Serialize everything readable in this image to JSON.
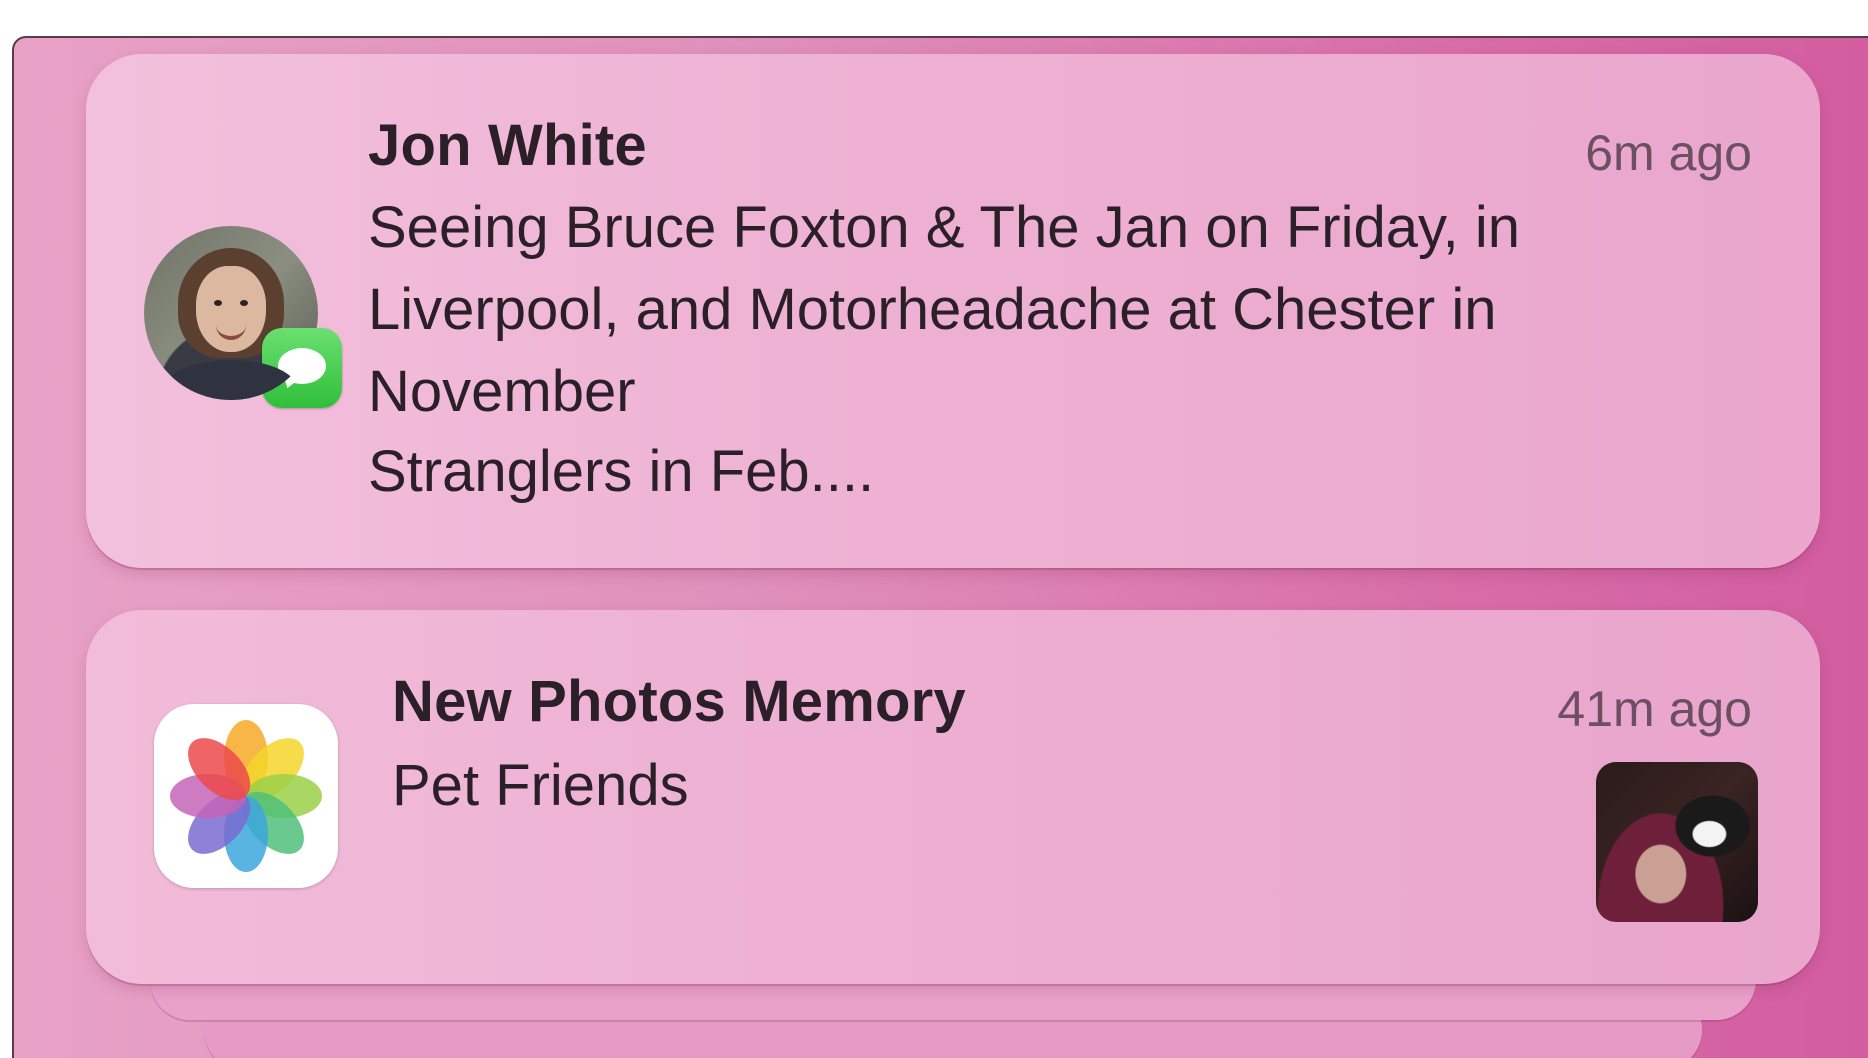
{
  "notifications": [
    {
      "sender": "Jon White",
      "time": "6m ago",
      "lines": [
        "Seeing Bruce Foxton & The Jan on Friday, in",
        "Liverpool, and Motorheadache at Chester in",
        "November",
        "Stranglers in Feb...."
      ],
      "app_icon": "messages-icon",
      "avatar": "contact-avatar"
    },
    {
      "title": "New Photos Memory",
      "subtitle": "Pet Friends",
      "time": "41m ago",
      "app_icon": "photos-icon",
      "thumbnail": "memory-thumbnail"
    }
  ],
  "colors": {
    "background_pink": "#d86ea9",
    "card_pink": "#eeb1d3",
    "messages_green": "#34c759"
  }
}
